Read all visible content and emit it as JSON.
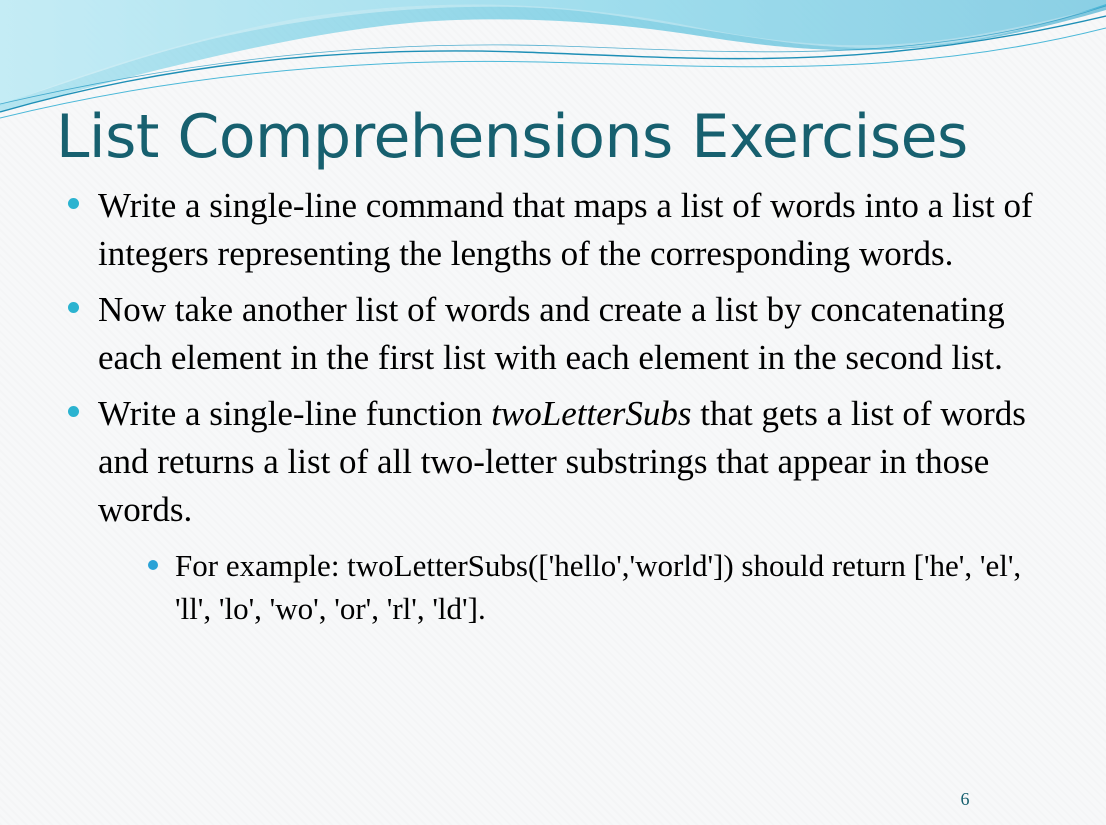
{
  "slide": {
    "title": "List Comprehensions Exercises",
    "accent_color": "#17606f",
    "bullet_color": "#2bb3d0",
    "bullets": [
      {
        "text": "Write a single-line command that maps a list of words into a list of integers representing the lengths of the corresponding words."
      },
      {
        "text": "Now take another list of words and create a list by concatenating each element in the first list with each element in the second list."
      },
      {
        "text_before": "Write a single-line function ",
        "emphasis": "twoLetterSubs",
        "text_after": " that gets a list of words and returns a list of all two-letter substrings that appear in those words.",
        "sub_bullets": [
          {
            "text": "For example: twoLetterSubs(['hello','world']) should return ['he', 'el', 'll', 'lo', 'wo', 'or', 'rl', 'ld']."
          }
        ]
      }
    ],
    "page_number": "6"
  }
}
